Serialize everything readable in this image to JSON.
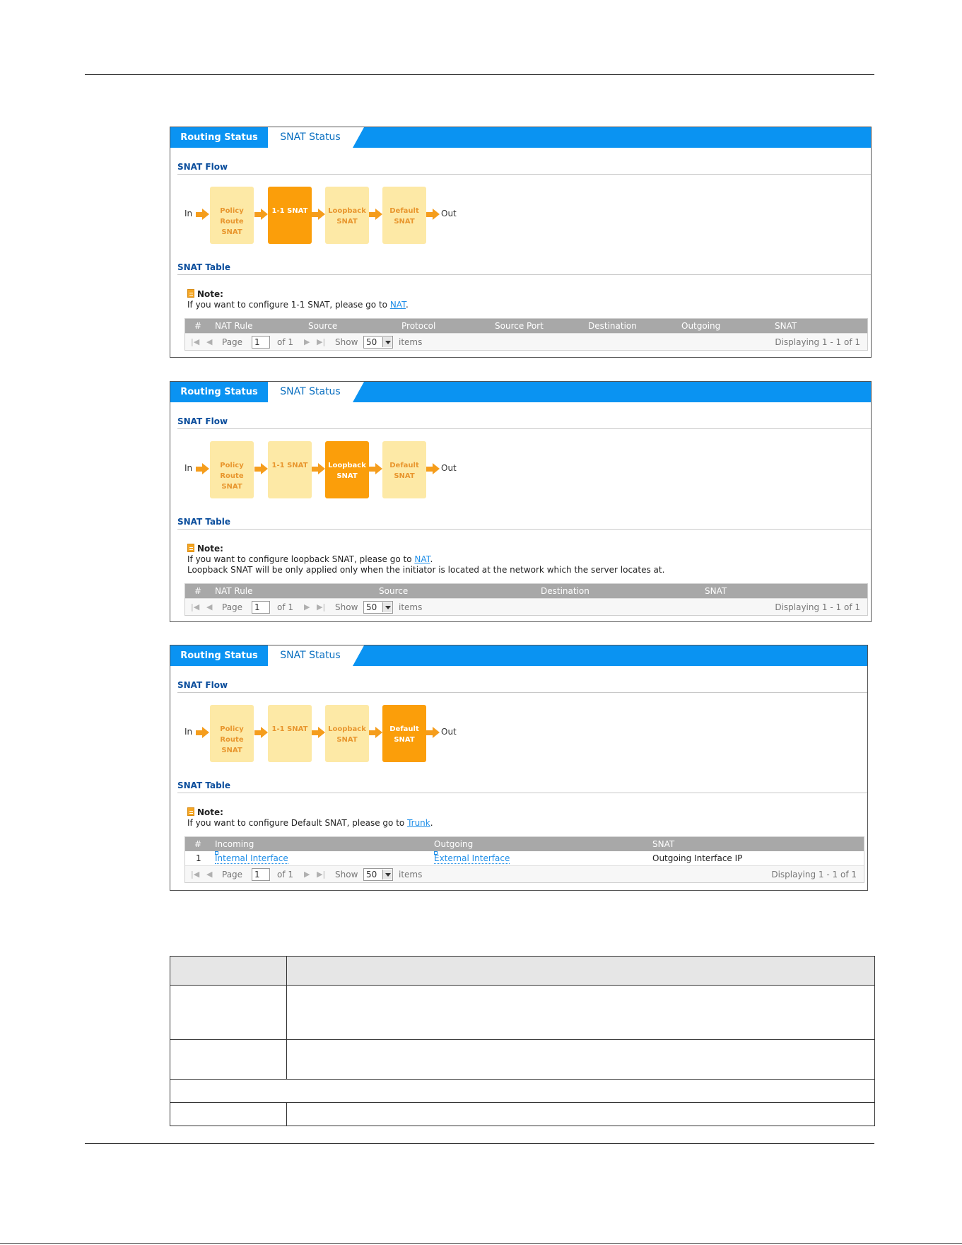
{
  "panels": [
    {
      "tabs": {
        "routing": "Routing Status",
        "snat": "SNAT Status"
      },
      "flow_title": "SNAT Flow",
      "flow": {
        "in": "In",
        "out": "Out",
        "steps": [
          {
            "label": "Policy Route SNAT",
            "active": false
          },
          {
            "label": "1-1 SNAT",
            "active": true
          },
          {
            "label": "Loopback SNAT",
            "active": false
          },
          {
            "label": "Default SNAT",
            "active": false
          }
        ]
      },
      "table_title": "SNAT Table",
      "note": {
        "head": "Note:",
        "line1_pre": "If you want to configure 1-1 SNAT, please go to ",
        "line1_link": "NAT",
        "line1_post": ".",
        "line2": ""
      },
      "columns": [
        "#",
        "NAT Rule",
        "Source",
        "Protocol",
        "Source Port",
        "Destination",
        "Outgoing",
        "SNAT"
      ],
      "rows": [],
      "pager": {
        "page_label": "Page",
        "page": "1",
        "of": "of 1",
        "show": "Show",
        "per_page": "50",
        "items": "items",
        "displaying": "Displaying 1 - 1 of 1"
      }
    },
    {
      "tabs": {
        "routing": "Routing Status",
        "snat": "SNAT Status"
      },
      "flow_title": "SNAT Flow",
      "flow": {
        "in": "In",
        "out": "Out",
        "steps": [
          {
            "label": "Policy Route SNAT",
            "active": false
          },
          {
            "label": "1-1 SNAT",
            "active": false
          },
          {
            "label": "Loopback SNAT",
            "active": true
          },
          {
            "label": "Default SNAT",
            "active": false
          }
        ]
      },
      "table_title": "SNAT Table",
      "note": {
        "head": "Note:",
        "line1_pre": "If you want to configure loopback SNAT, please go to ",
        "line1_link": "NAT",
        "line1_post": ".",
        "line2": "Loopback SNAT will be only applied only when the initiator is located at the network which the server locates at."
      },
      "columns": [
        "#",
        "NAT Rule",
        "Source",
        "Destination",
        "SNAT"
      ],
      "rows": [],
      "pager": {
        "page_label": "Page",
        "page": "1",
        "of": "of 1",
        "show": "Show",
        "per_page": "50",
        "items": "items",
        "displaying": "Displaying 1 - 1 of 1"
      }
    },
    {
      "tabs": {
        "routing": "Routing Status",
        "snat": "SNAT Status"
      },
      "flow_title": "SNAT Flow",
      "flow": {
        "in": "In",
        "out": "Out",
        "steps": [
          {
            "label": "Policy Route SNAT",
            "active": false
          },
          {
            "label": "1-1 SNAT",
            "active": false
          },
          {
            "label": "Loopback SNAT",
            "active": false
          },
          {
            "label": "Default SNAT",
            "active": true
          }
        ]
      },
      "table_title": "SNAT Table",
      "note": {
        "head": "Note:",
        "line1_pre": "If you want to configure Default SNAT, please go to ",
        "line1_link": "Trunk",
        "line1_post": ".",
        "line2": ""
      },
      "columns": [
        "#",
        "Incoming",
        "Outgoing",
        "SNAT"
      ],
      "rows": [
        {
          "num": "1",
          "incoming": "Internal Interface",
          "outgoing": "External Interface",
          "snat": "Outgoing Interface IP"
        }
      ],
      "pager": {
        "page_label": "Page",
        "page": "1",
        "of": "of 1",
        "show": "Show",
        "per_page": "50",
        "items": "items",
        "displaying": "Displaying 1 - 1 of 1"
      }
    }
  ]
}
